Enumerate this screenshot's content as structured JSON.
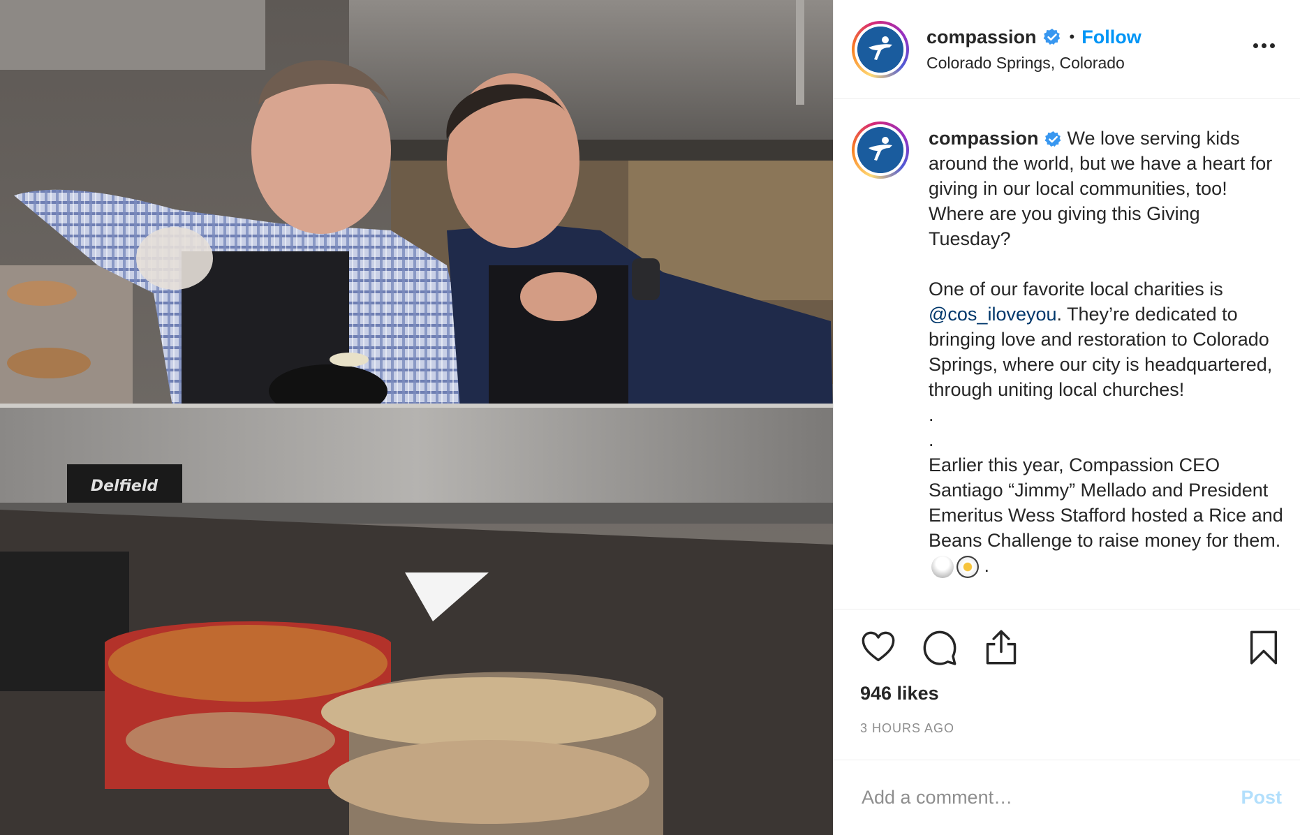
{
  "post": {
    "username": "compassion",
    "follow_label": "Follow",
    "separator": "•",
    "location": "Colorado Springs, Colorado",
    "caption": {
      "username": "compassion",
      "intro": "We love serving kids around the world, but we have a heart for giving in our local communities, too! Where are you giving this Giving Tuesday?",
      "para2_before": "One of our favorite local charities is ",
      "mention": "@cos_iloveyou",
      "para2_after": ". They’re dedicated to bringing love and restoration to Colorado Springs, where our city is headquartered, through uniting local churches!",
      "dot1": ".",
      "dot2": ".",
      "para3": "Earlier this year, Compassion CEO Santiago “Jimmy” Mellado and President Emeritus Wess Stafford hosted a Rice and Beans Challenge to raise money for them.",
      "trailing": "."
    },
    "likes": "946 likes",
    "time": "3 HOURS AGO",
    "comment_placeholder": "Add a comment…",
    "post_label": "Post",
    "photo_sign_text": "Delfield"
  },
  "colors": {
    "accent": "#0095f6",
    "mention": "#00376b",
    "muted": "#8e8e8e",
    "verified": "#3897f0",
    "brand": "#1a5c9e"
  },
  "icons": [
    "verified-icon",
    "more-options-icon",
    "heart-icon",
    "comment-icon",
    "share-icon",
    "bookmark-icon"
  ]
}
